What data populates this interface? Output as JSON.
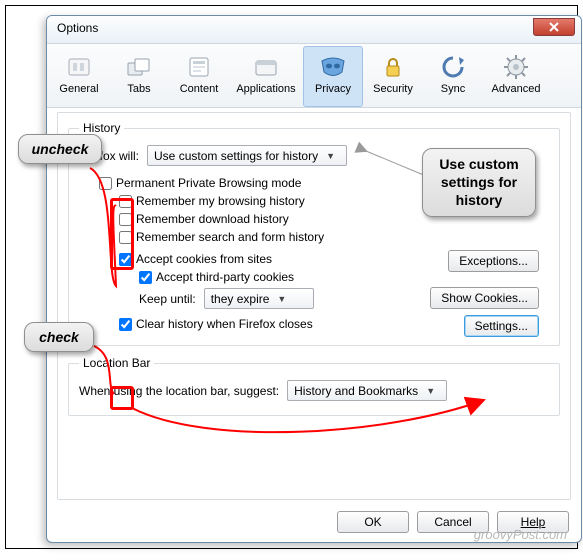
{
  "window": {
    "title": "Options"
  },
  "tabs": {
    "general": "General",
    "tabs": "Tabs",
    "content": "Content",
    "applications": "Applications",
    "privacy": "Privacy",
    "security": "Security",
    "sync": "Sync",
    "advanced": "Advanced"
  },
  "history": {
    "legend": "History",
    "will_label": "Firefox will:",
    "will_value": "Use custom settings for history",
    "permanent_pb": "Permanent Private Browsing mode",
    "remember_browsing": "Remember my browsing history",
    "remember_download": "Remember download history",
    "remember_forms": "Remember search and form history",
    "accept_cookies": "Accept cookies from sites",
    "exceptions_btn": "Exceptions...",
    "accept_third": "Accept third-party cookies",
    "keep_until_label": "Keep until:",
    "keep_until_value": "they expire",
    "show_cookies_btn": "Show Cookies...",
    "clear_on_close": "Clear history when Firefox closes",
    "settings_btn": "Settings..."
  },
  "locationbar": {
    "legend": "Location Bar",
    "suggest_label": "When using the location bar, suggest:",
    "suggest_value": "History and Bookmarks"
  },
  "buttons": {
    "ok": "OK",
    "cancel": "Cancel",
    "help": "Help"
  },
  "annotations": {
    "uncheck": "uncheck",
    "check": "check",
    "use_custom": "Use custom settings for history"
  },
  "watermark": "groovyPost.com"
}
